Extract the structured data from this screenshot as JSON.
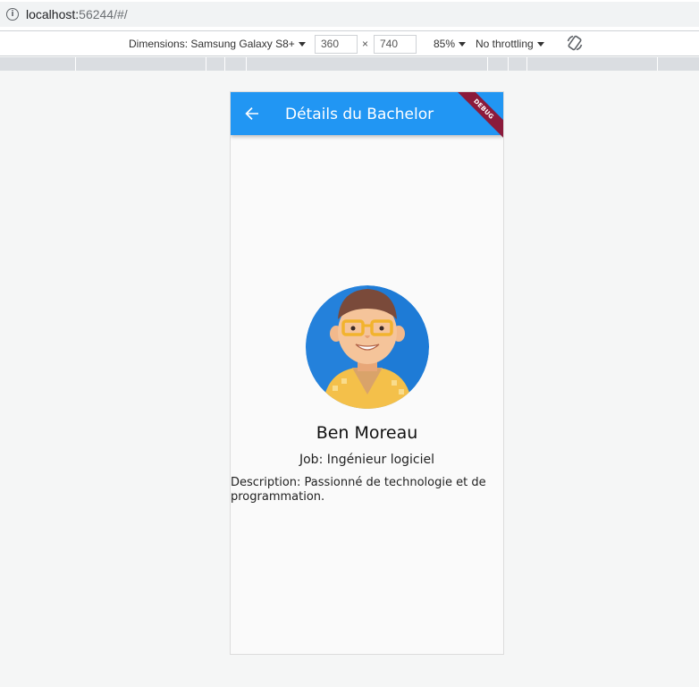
{
  "browser": {
    "url_host": "localhost:",
    "url_rest": "56244/#/"
  },
  "devicebar": {
    "dimensions_label": "Dimensions: Samsung Galaxy S8+",
    "width_value": "360",
    "times": "×",
    "height_value": "740",
    "zoom": "85%",
    "throttling": "No throttling"
  },
  "app": {
    "title": "Détails du Bachelor",
    "debug_banner": "DEBUG",
    "accent_color": "#2196f3"
  },
  "profile": {
    "name": "Ben Moreau",
    "job": "Job: Ingénieur logiciel",
    "description": "Description: Passionné de technologie et de programmation."
  }
}
